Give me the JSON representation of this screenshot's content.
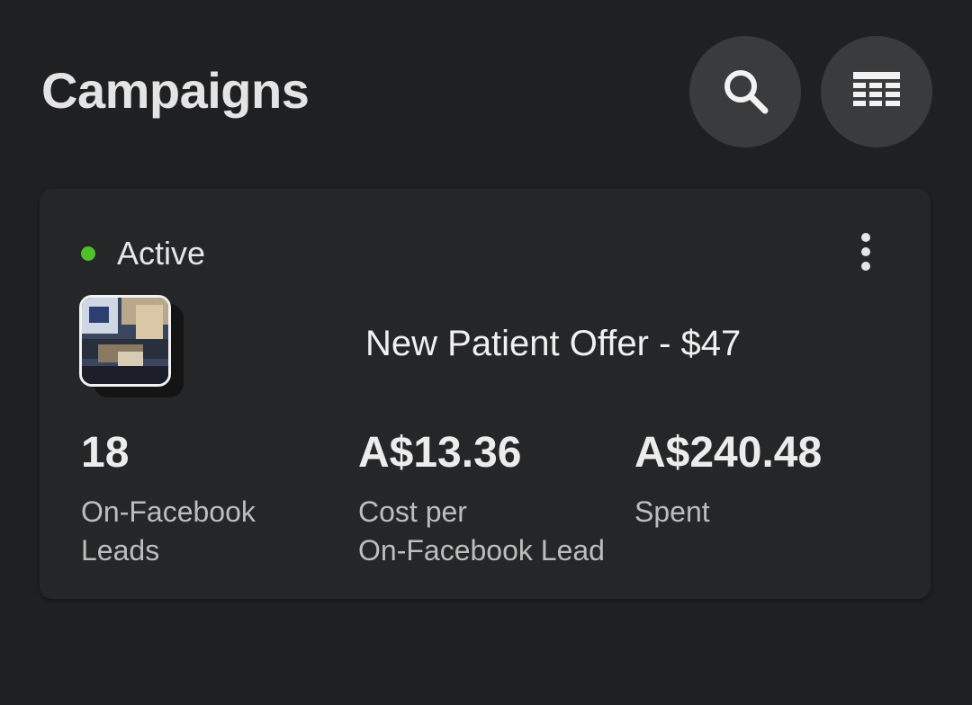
{
  "header": {
    "title": "Campaigns",
    "search_icon": "search-icon",
    "table_icon": "table-view-icon"
  },
  "campaign": {
    "status": "Active",
    "status_color": "#4fc02a",
    "name": "New Patient Offer - $47",
    "thumbnail_icon": "campaign-thumbnail",
    "more_icon": "more-vertical-icon",
    "metrics": [
      {
        "value": "18",
        "label_line1": "On-Facebook",
        "label_line2": "Leads"
      },
      {
        "value": "A$13.36",
        "label_line1": "Cost per",
        "label_line2": "On-Facebook Lead"
      },
      {
        "value": "A$240.48",
        "label_line1": "Spent",
        "label_line2": ""
      }
    ]
  },
  "colors": {
    "background": "#1f2021",
    "card": "#252627",
    "button": "#3a3b3c"
  }
}
